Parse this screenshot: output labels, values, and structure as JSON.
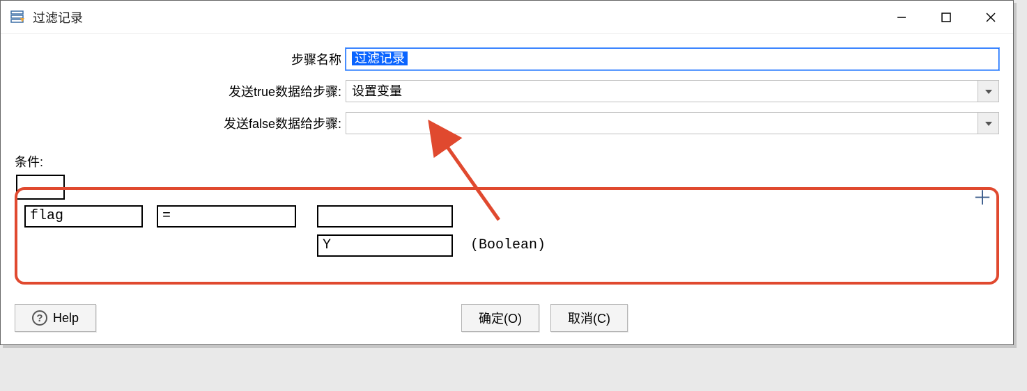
{
  "window": {
    "title": "过滤记录"
  },
  "form": {
    "step_name_label": "步骤名称",
    "step_name_value": "过滤记录",
    "send_true_label": "发送true数据给步骤:",
    "send_true_value": "设置变量",
    "send_false_label": "发送false数据给步骤:",
    "send_false_value": ""
  },
  "conditions": {
    "label": "条件:",
    "field": "flag",
    "operator": "=",
    "value_top": "",
    "value_bottom": "Y",
    "type_hint": "(Boolean)"
  },
  "buttons": {
    "help": "Help",
    "ok": "确定(O)",
    "cancel": "取消(C)"
  }
}
